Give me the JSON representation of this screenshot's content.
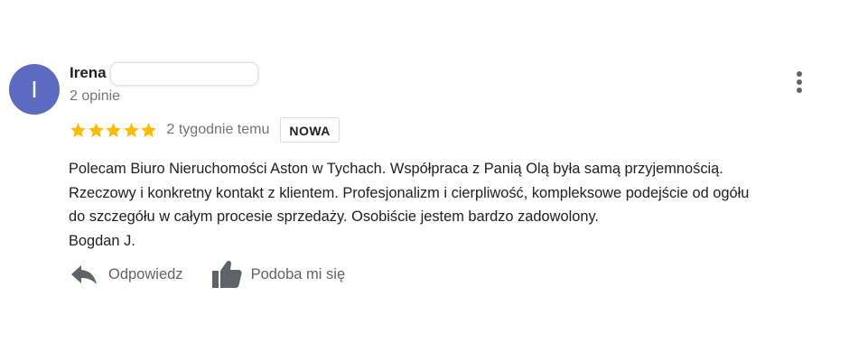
{
  "review": {
    "avatar_letter": "I",
    "avatar_color": "#5c6bc0",
    "author_name": "Irena",
    "review_count": "2 opinie",
    "rating": 5,
    "rating_max": 5,
    "star_color": "#fbbc04",
    "date": "2 tygodnie temu",
    "badge": "NOWA",
    "text_lines": [
      "Polecam Biuro Nieruchomości Aston w Tychach. Współpraca z Panią Olą była samą przyjemnością.",
      "Rzeczowy i konkretny kontakt z klientem. Profesjonalizm i cierpliwość, kompleksowe podejście od ogółu",
      "do szczegółu w całym procesie sprzedaży. Osobiście jestem bardzo zadowolony.",
      "Bogdan J."
    ],
    "actions": {
      "reply_label": "Odpowiedz",
      "like_label": "Podoba mi się"
    },
    "icons": {
      "more": "more-vert-icon",
      "reply": "reply-icon",
      "like": "thumb-up-icon",
      "star": "star-icon"
    }
  }
}
